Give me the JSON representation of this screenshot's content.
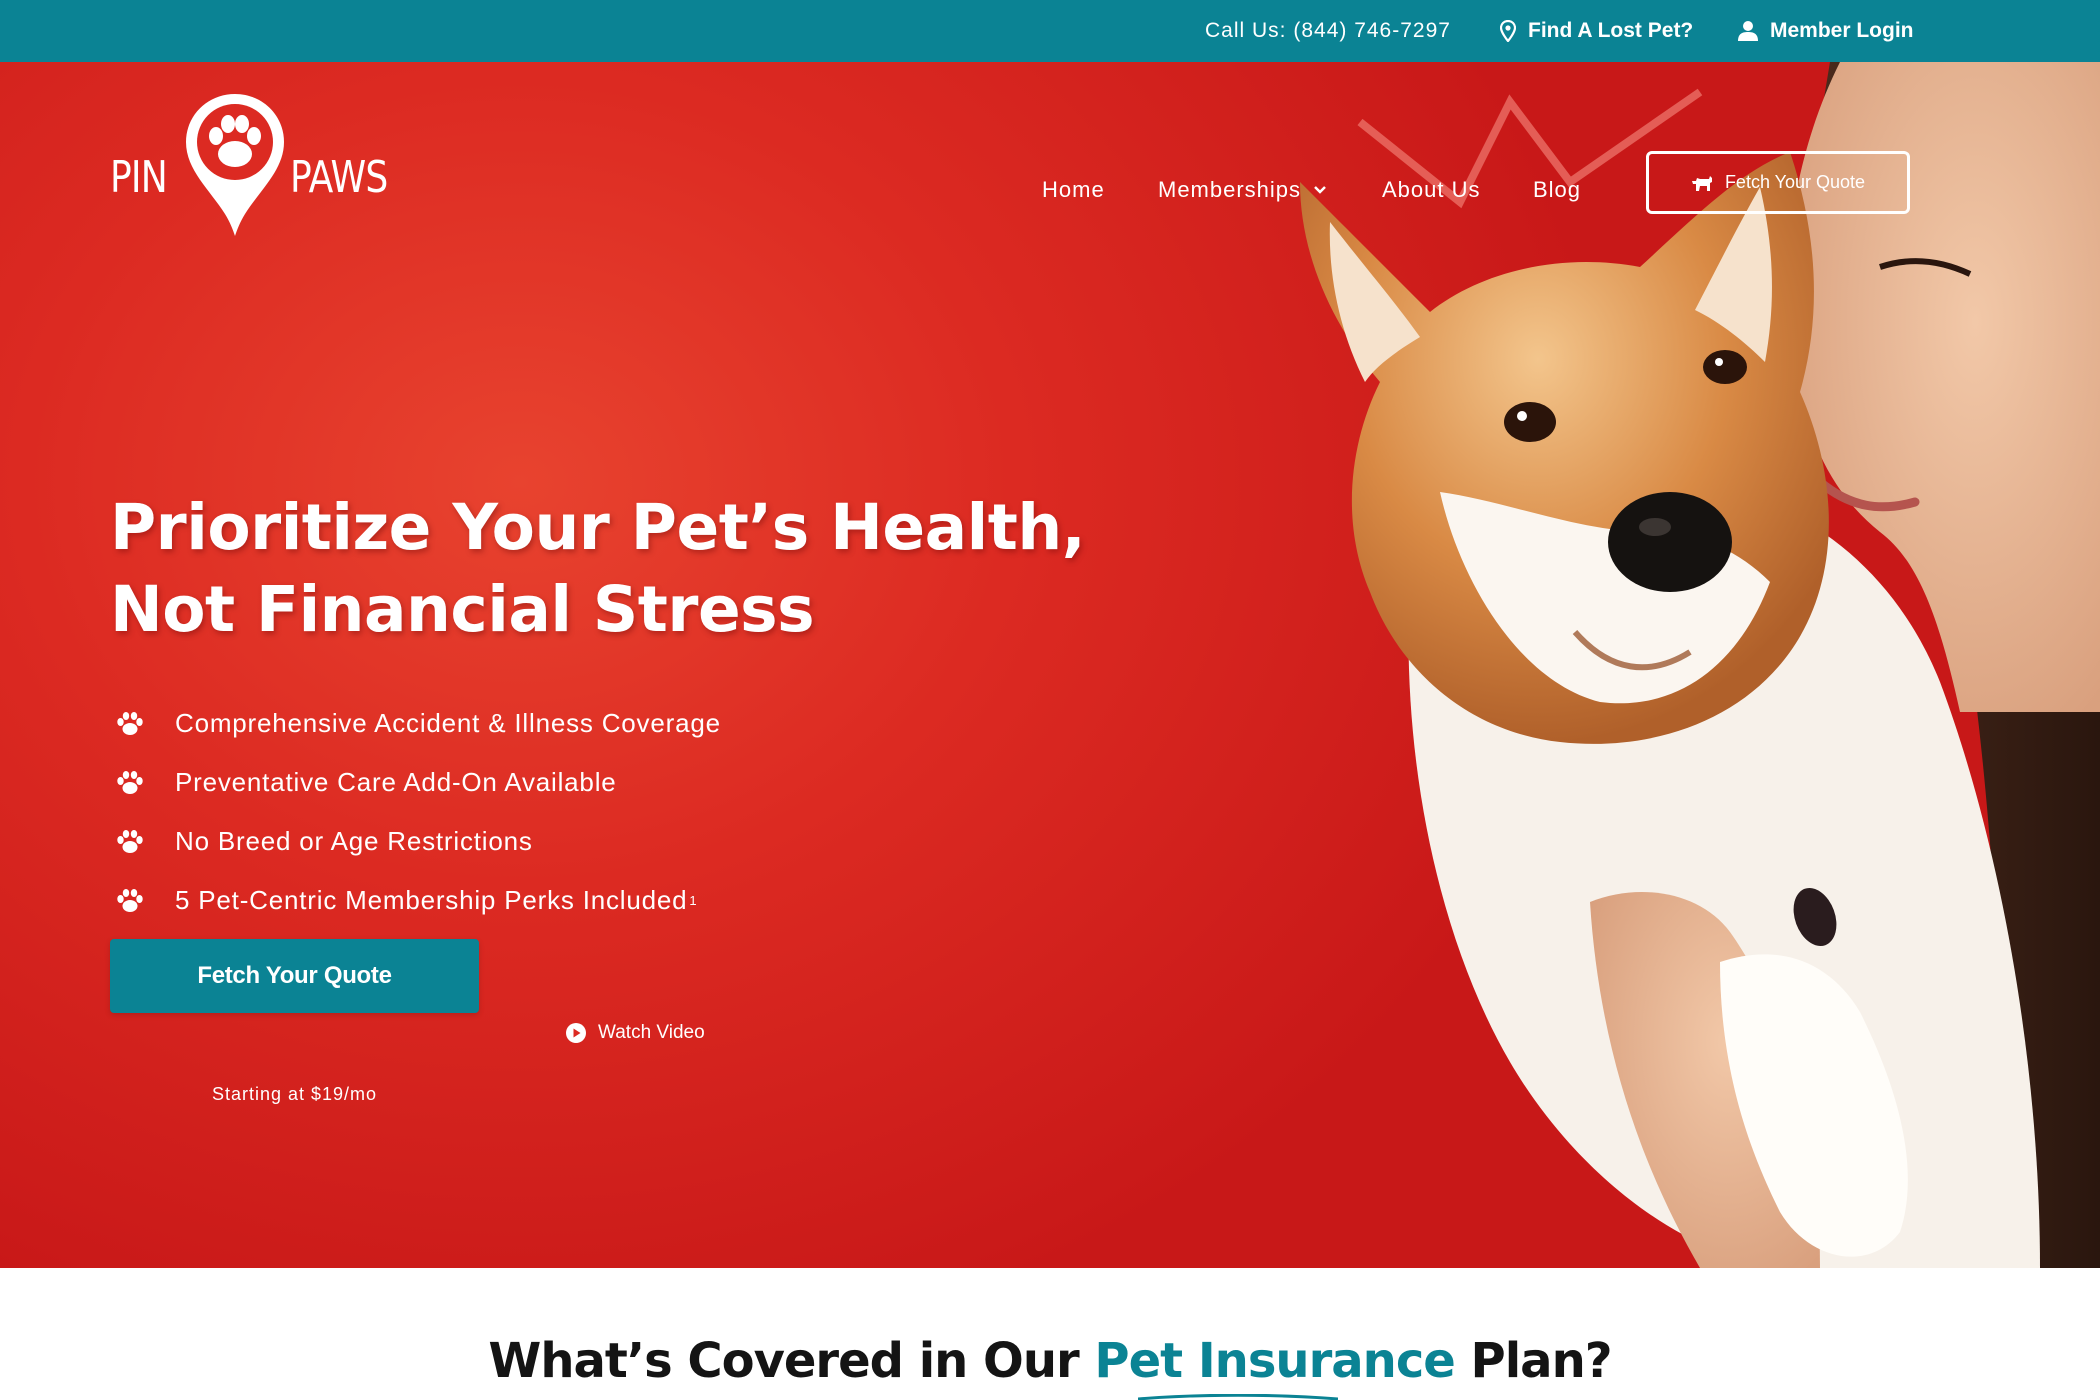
{
  "topbar": {
    "phone": "Call Us: (844) 746-7297",
    "lost_pet": "Find A Lost Pet?",
    "member_login": "Member Login"
  },
  "logo": {
    "left_word": "PIN",
    "right_word": "PAWS"
  },
  "nav": {
    "home": "Home",
    "memberships": "Memberships",
    "about": "About Us",
    "blog": "Blog",
    "quote_button": "Fetch Your Quote"
  },
  "hero": {
    "headline_line1": "Prioritize Your Pet’s Health,",
    "headline_line2": "Not Financial Stress",
    "features": [
      {
        "text": "Comprehensive Accident & Illness Coverage",
        "sup": ""
      },
      {
        "text": "Preventative Care Add-On Available",
        "sup": ""
      },
      {
        "text": "No Breed or Age Restrictions",
        "sup": ""
      },
      {
        "text": "5 Pet-Centric Membership Perks Included",
        "sup": "1"
      }
    ],
    "cta_label": "Fetch Your Quote",
    "cta_note": "Starting at $19/mo",
    "watch_video": "Watch Video"
  },
  "coverage": {
    "title_prefix": "What’s Covered in Our ",
    "title_highlight": "Pet Insurance",
    "title_suffix": " Plan?"
  },
  "colors": {
    "brand_teal": "#0b8394",
    "hero_red": "#dc2a22",
    "text_dark": "#141414"
  },
  "icons": {
    "lost_pet": "map-pin-icon",
    "login": "user-icon",
    "quote": "dog-icon",
    "feature": "paw-icon",
    "video": "play-circle-icon"
  }
}
